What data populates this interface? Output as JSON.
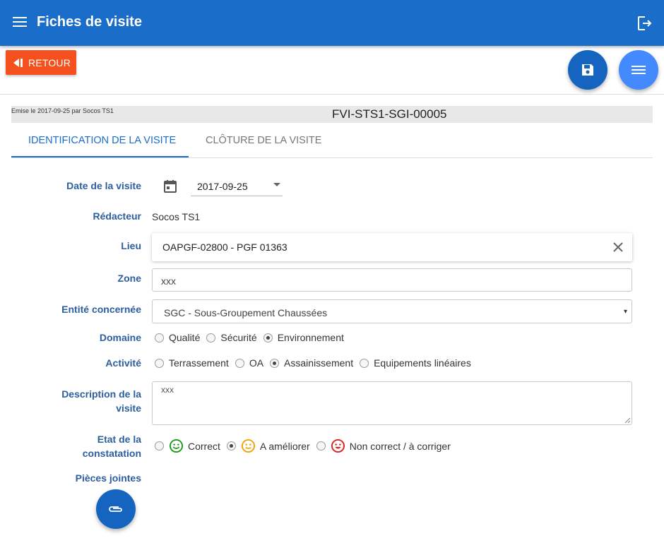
{
  "appbar": {
    "title": "Fiches de visite",
    "menu_icon": "hamburger-menu-icon",
    "logout_icon": "logout-icon",
    "color": "#1a6dc9"
  },
  "toolbar": {
    "back_label": "RETOUR",
    "back_color": "#f4511e",
    "save_icon": "floppy-save-icon",
    "menu_icon": "list-menu-icon"
  },
  "header": {
    "emitted": "Emise le 2017-09-25 par Socos TS1",
    "code": "FVI-STS1-SGI-00005"
  },
  "tabs": [
    {
      "label": "IDENTIFICATION DE LA VISITE",
      "active": true
    },
    {
      "label": "CLÔTURE DE LA VISITE",
      "active": false
    }
  ],
  "form": {
    "date": {
      "label": "Date de la visite",
      "value": "2017-09-25",
      "icon": "calendar-icon"
    },
    "redacteur": {
      "label": "Rédacteur",
      "value": "Socos TS1"
    },
    "lieu": {
      "label": "Lieu",
      "value": "OAPGF-02800 - PGF 01363",
      "clear_icon": "close-icon"
    },
    "zone": {
      "label": "Zone",
      "value": "xxx"
    },
    "entite": {
      "label": "Entité concernée",
      "value": "SGC - Sous-Groupement Chaussées"
    },
    "domaine": {
      "label": "Domaine",
      "options": [
        {
          "label": "Qualité",
          "checked": false
        },
        {
          "label": "Sécurité",
          "checked": false
        },
        {
          "label": "Environnement",
          "checked": true
        }
      ]
    },
    "activite": {
      "label": "Activité",
      "options": [
        {
          "label": "Terrassement",
          "checked": false
        },
        {
          "label": "OA",
          "checked": false
        },
        {
          "label": "Assainissement",
          "checked": true
        },
        {
          "label": "Equipements linéaires",
          "checked": false
        }
      ]
    },
    "description": {
      "label_line1": "Description de la",
      "label_line2": "visite",
      "value": "xxx"
    },
    "etat": {
      "label_line1": "Etat de la",
      "label_line2": "constatation",
      "options": [
        {
          "label": "Correct",
          "checked": false,
          "icon": "smiley-happy-icon",
          "color": "#1e9b1e"
        },
        {
          "label": "A améliorer",
          "checked": true,
          "icon": "smiley-neutral-icon",
          "color": "#f0a30a"
        },
        {
          "label": "Non correct / à corriger",
          "checked": false,
          "icon": "smiley-sad-icon",
          "color": "#e02020"
        }
      ]
    },
    "pieces": {
      "label": "Pièces jointes",
      "icon": "paperclip-icon"
    }
  }
}
